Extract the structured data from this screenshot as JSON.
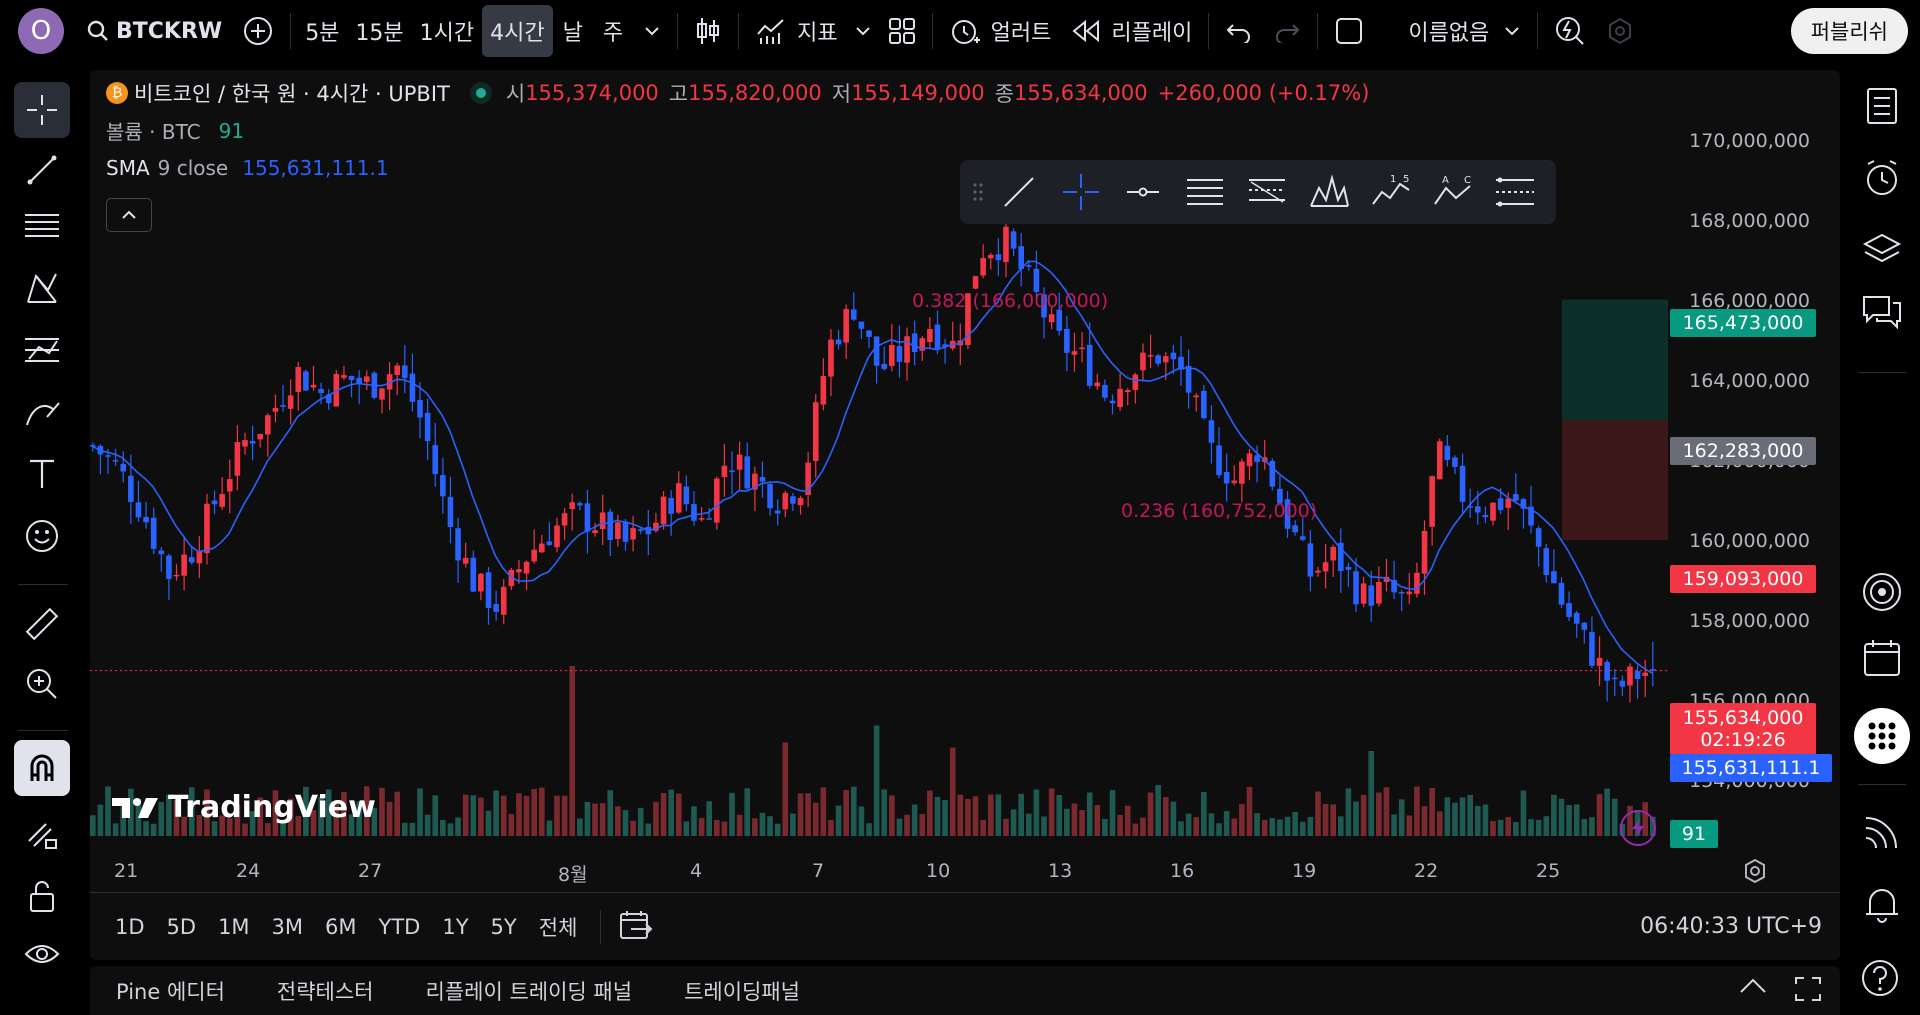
{
  "topbar": {
    "avatar": "O",
    "symbol": "BTCKRW",
    "intervals": [
      "5분",
      "15분",
      "1시간",
      "4시간",
      "날",
      "주"
    ],
    "active_interval": "4시간",
    "indicators": "지표",
    "alert": "얼러트",
    "replay": "리플레이",
    "layout_name": "이름없음",
    "publish": "퍼블리쉬"
  },
  "legend": {
    "title": "비트코인 / 한국 원 · 4시간 · UPBIT",
    "open_label": "시",
    "open": "155,374,000",
    "high_label": "고",
    "high": "155,820,000",
    "low_label": "저",
    "low": "155,149,000",
    "close_label": "종",
    "close": "155,634,000",
    "change": "+260,000 (+0.17%)",
    "volume_label": "볼륨 · BTC",
    "volume_value": "91",
    "sma_label": "SMA",
    "sma_params": "9 close",
    "sma_value": "155,631,111.1"
  },
  "price_axis": {
    "ticks": [
      "170,000,000",
      "168,000,000",
      "166,000,000",
      "164,000,000",
      "162,000,000",
      "160,000,000",
      "158,000,000",
      "156,000,000",
      "154,000,000"
    ],
    "tags": {
      "target": "165,473,000",
      "entry": "162,283,000",
      "stop": "159,093,000",
      "last": "155,634,000",
      "countdown": "02:19:26",
      "sma": "155,631,111.1",
      "volume": "91"
    }
  },
  "time_axis": {
    "ticks": [
      "21",
      "24",
      "27",
      "8월",
      "4",
      "7",
      "10",
      "13",
      "16",
      "19",
      "22",
      "25"
    ]
  },
  "annotations": {
    "fib_upper": "(166,000,000)",
    "fib_lower": "(160,752,000)",
    "fib_upper_ratio": "0.382",
    "fib_lower_ratio": "0.236"
  },
  "range_bar": {
    "ranges": [
      "1D",
      "5D",
      "1M",
      "3M",
      "6M",
      "YTD",
      "1Y",
      "5Y",
      "전체"
    ],
    "clock": "06:40:33 UTC+9"
  },
  "bottom_tabs": [
    "Pine 에디터",
    "전략테스터",
    "리플레이 트레이딩 패널",
    "트레이딩패널"
  ],
  "watermark": "TradingView",
  "colors": {
    "up": "#f23645",
    "down": "#2962ff",
    "vol_up": "#7a2a2f",
    "vol_down": "#1f5a52",
    "sma": "#2962ff",
    "accent": "#089981"
  },
  "chart_data": {
    "type": "candlestick",
    "title": "비트코인 / 한국 원 · 4시간 · UPBIT",
    "ylim": [
      153000000,
      170500000
    ],
    "last_close": 155634000,
    "sma_last": 155631111.1,
    "x_ticks": [
      "21",
      "24",
      "27",
      "8월",
      "4",
      "7",
      "10",
      "13",
      "16",
      "19",
      "22",
      "25"
    ],
    "close_path": [
      [
        0,
        161600000
      ],
      [
        10,
        161000000
      ],
      [
        20,
        159800000
      ],
      [
        30,
        158200000
      ],
      [
        40,
        158900000
      ],
      [
        50,
        160400000
      ],
      [
        60,
        161700000
      ],
      [
        70,
        162400000
      ],
      [
        80,
        163600000
      ],
      [
        90,
        163000000
      ],
      [
        100,
        163400000
      ],
      [
        110,
        163200000
      ],
      [
        120,
        163700000
      ],
      [
        130,
        162200000
      ],
      [
        140,
        159600000
      ],
      [
        150,
        158000000
      ],
      [
        160,
        157300000
      ],
      [
        170,
        158600000
      ],
      [
        180,
        159300000
      ],
      [
        190,
        159800000
      ],
      [
        200,
        159500000
      ],
      [
        210,
        159000000
      ],
      [
        220,
        159400000
      ],
      [
        230,
        160400000
      ],
      [
        240,
        159600000
      ],
      [
        250,
        161300000
      ],
      [
        260,
        160800000
      ],
      [
        270,
        160200000
      ],
      [
        280,
        160600000
      ],
      [
        290,
        164200000
      ],
      [
        300,
        165300000
      ],
      [
        310,
        163600000
      ],
      [
        320,
        164100000
      ],
      [
        330,
        164800000
      ],
      [
        340,
        164200000
      ],
      [
        350,
        166800000
      ],
      [
        360,
        167000000
      ],
      [
        370,
        165800000
      ],
      [
        380,
        164400000
      ],
      [
        390,
        163900000
      ],
      [
        400,
        162900000
      ],
      [
        410,
        163600000
      ],
      [
        420,
        164000000
      ],
      [
        430,
        163500000
      ],
      [
        440,
        161500000
      ],
      [
        450,
        160700000
      ],
      [
        460,
        161600000
      ],
      [
        470,
        159800000
      ],
      [
        480,
        158200000
      ],
      [
        490,
        158700000
      ],
      [
        500,
        157600000
      ],
      [
        510,
        157800000
      ],
      [
        520,
        157300000
      ],
      [
        530,
        161400000
      ],
      [
        540,
        160300000
      ],
      [
        550,
        159900000
      ],
      [
        560,
        160300000
      ],
      [
        570,
        158900000
      ],
      [
        580,
        157300000
      ],
      [
        590,
        156200000
      ],
      [
        600,
        155100000
      ],
      [
        610,
        155600000
      ]
    ],
    "volume_spikes": [
      [
        188,
        1.0
      ],
      [
        273,
        0.55
      ],
      [
        310,
        0.65
      ],
      [
        340,
        0.52
      ],
      [
        420,
        0.3
      ],
      [
        505,
        0.5
      ]
    ]
  }
}
